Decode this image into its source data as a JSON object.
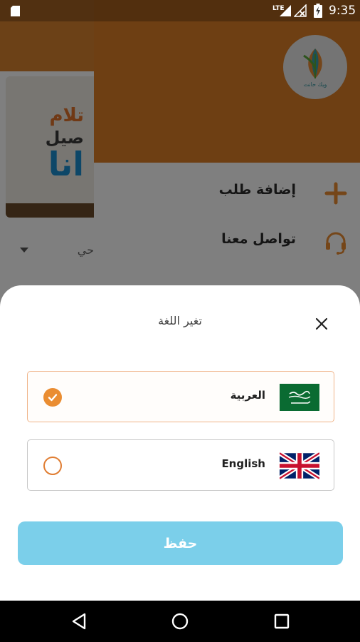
{
  "status_bar": {
    "network": "LTE",
    "time": "9:35"
  },
  "background": {
    "banner": {
      "line1": "تلام",
      "line2": "صيل",
      "line3": "انا"
    },
    "select_text": "حي"
  },
  "drawer": {
    "logo_text": "ويك حانت",
    "items": [
      {
        "label": "إضافة طلب",
        "icon": "plus-icon"
      },
      {
        "label": "تواصل معنا",
        "icon": "headset-icon"
      }
    ]
  },
  "language_sheet": {
    "title": "تغير اللغة",
    "options": [
      {
        "label": "العربية",
        "flag": "saudi-flag-icon",
        "selected": true
      },
      {
        "label": "English",
        "flag": "uk-flag-icon",
        "selected": false
      }
    ],
    "save_label": "حفظ"
  },
  "colors": {
    "accent_orange": "#ea8d32",
    "header_orange": "#dd7e27",
    "save_button": "#7bcfea",
    "selected_border": "#f0b489"
  }
}
